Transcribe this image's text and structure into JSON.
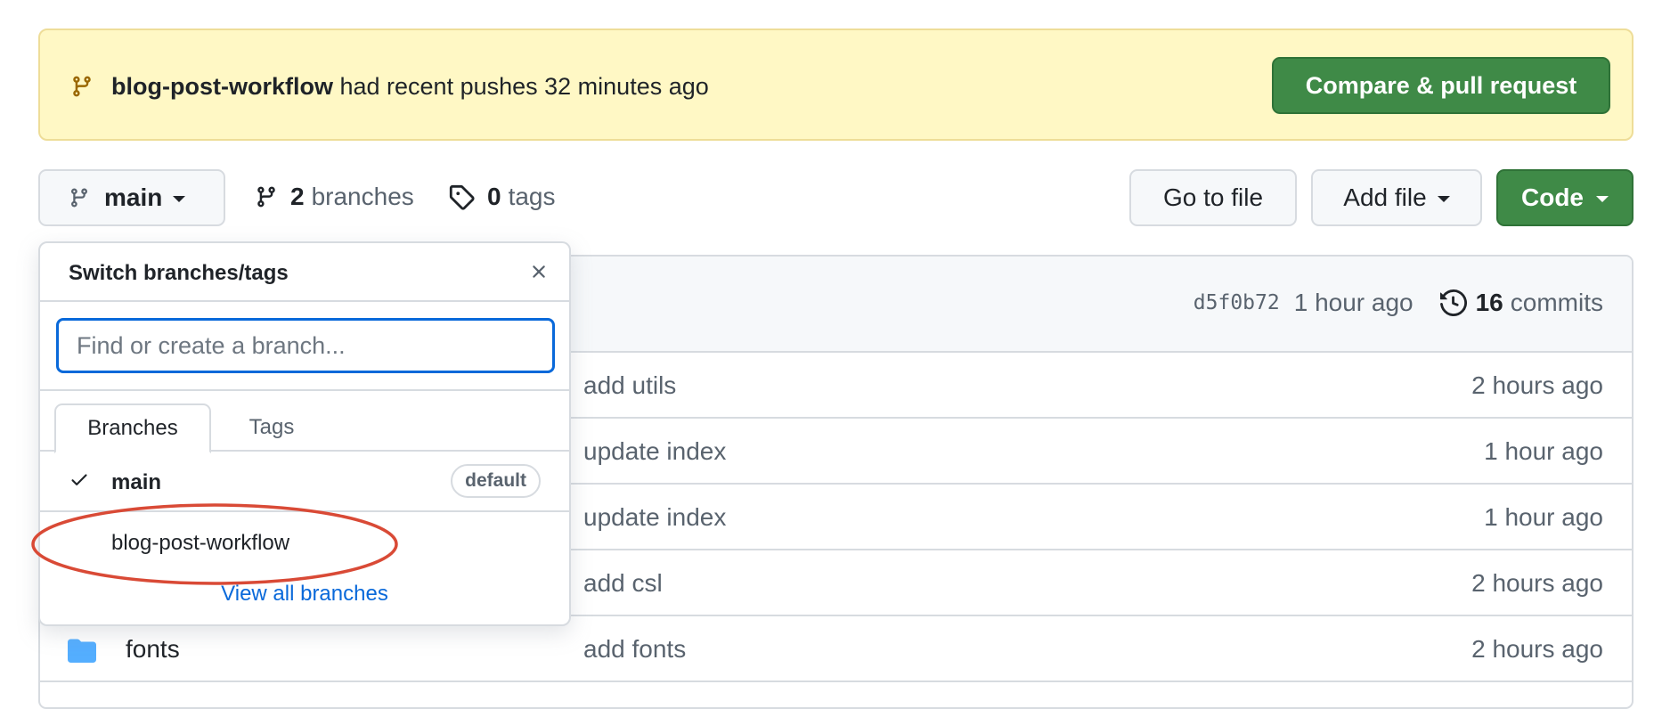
{
  "banner": {
    "branch": "blog-post-workflow",
    "message": "had recent pushes 32 minutes ago",
    "compare_button": "Compare & pull request"
  },
  "toolbar": {
    "current_branch": "main",
    "branches_count": "2",
    "branches_label": "branches",
    "tags_count": "0",
    "tags_label": "tags",
    "go_to_file": "Go to file",
    "add_file": "Add file",
    "code": "Code"
  },
  "latest_commit": {
    "sha": "d5f0b72",
    "time": "1 hour ago",
    "commits_count": "16",
    "commits_label": "commits"
  },
  "files": [
    {
      "name": "",
      "message": "add utils",
      "time": "2 hours ago"
    },
    {
      "name": "",
      "message": "update index",
      "time": "1 hour ago"
    },
    {
      "name": "",
      "message": "update index",
      "time": "1 hour ago"
    },
    {
      "name": "",
      "message": "add csl",
      "time": "2 hours ago"
    },
    {
      "name": "fonts",
      "message": "add fonts",
      "time": "2 hours ago"
    }
  ],
  "dropdown": {
    "title": "Switch branches/tags",
    "search_placeholder": "Find or create a branch...",
    "tabs": [
      "Branches",
      "Tags"
    ],
    "branches": [
      {
        "name": "main",
        "badge": "default",
        "selected": true
      },
      {
        "name": "blog-post-workflow"
      }
    ],
    "view_all": "View all branches"
  },
  "colors": {
    "banner_bg": "#fff8c5",
    "primary_green": "#3f8a47",
    "link_blue": "#0969da",
    "annotation_red": "#d94a36",
    "folder_blue": "#54aeff"
  },
  "icons": [
    "git-branch-icon",
    "tag-icon",
    "history-icon",
    "close-icon",
    "check-icon",
    "folder-icon"
  ]
}
